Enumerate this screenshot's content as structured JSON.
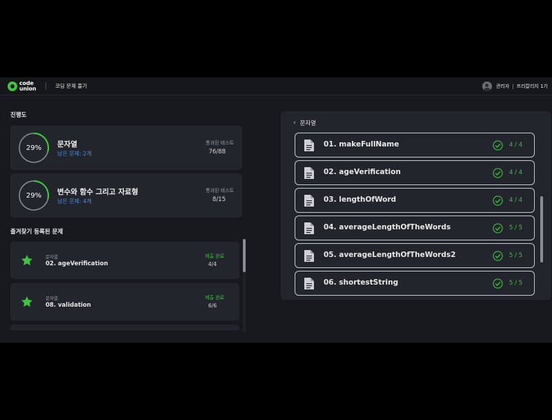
{
  "header": {
    "logo_line1": "code",
    "logo_line2": "union",
    "title": "코딩 문제 풀기",
    "user_role": "관리자",
    "separator": "|",
    "user_group": "프리칼리지 1기"
  },
  "progress": {
    "title": "진행도",
    "cards": [
      {
        "percent_label": "29%",
        "percent": 29,
        "name": "문자열",
        "remaining": "남은 문제: 2개",
        "stat_label": "통과된 테스트",
        "stat_value": "76/88"
      },
      {
        "percent_label": "29%",
        "percent": 29,
        "name": "변수와 함수 그리고 자료형",
        "remaining": "남은 문제: 4개",
        "stat_label": "통과된 테스트",
        "stat_value": "8/15"
      }
    ]
  },
  "favorites": {
    "title": "즐겨찾기 등록된 문제",
    "items": [
      {
        "category": "문자열",
        "name": "02. ageVerification",
        "status": "제출 완료",
        "count": "4/4"
      },
      {
        "category": "문자열",
        "name": "08. validation",
        "status": "제출 완료",
        "count": "6/6"
      }
    ]
  },
  "problems": {
    "back_label": "문자열",
    "items": [
      {
        "name": "01. makeFullName",
        "score": "4 / 4"
      },
      {
        "name": "02. ageVerification",
        "score": "4 / 4"
      },
      {
        "name": "03. lengthOfWord",
        "score": "4 / 4"
      },
      {
        "name": "04. averageLengthOfTheWords",
        "score": "5 / 5"
      },
      {
        "name": "05. averageLengthOfTheWords2",
        "score": "5 / 5"
      },
      {
        "name": "06. shortestString",
        "score": "5 / 5"
      }
    ]
  },
  "colors": {
    "accent_green": "#3ec43e",
    "link_blue": "#4a8fe0",
    "card_bg": "#22252b",
    "page_bg": "#17191e"
  },
  "icons": {
    "logo": "code-union-logo-icon",
    "avatar": "user-avatar-icon",
    "back": "chevron-left-icon",
    "problem": "document-icon",
    "passed": "check-circle-icon",
    "favorite": "star-icon"
  }
}
